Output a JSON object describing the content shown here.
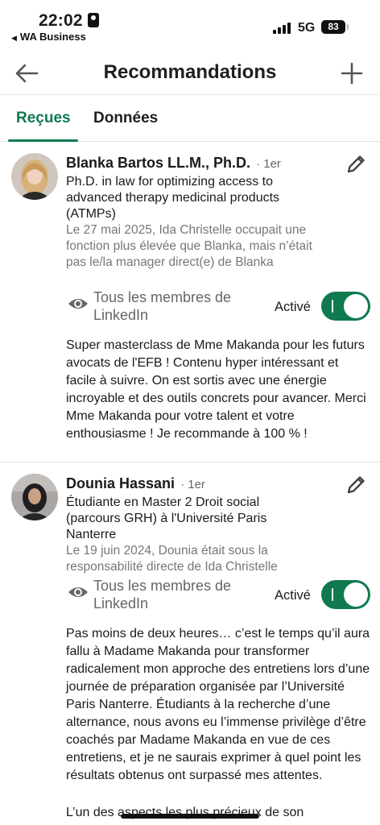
{
  "status_bar": {
    "time": "22:02",
    "back_app": "WA Business",
    "network": "5G",
    "battery": "83"
  },
  "header": {
    "title": "Recommandations",
    "back_icon": "arrow-left-icon",
    "add_icon": "plus-icon"
  },
  "tabs": [
    {
      "label": "Reçues",
      "active": true
    },
    {
      "label": "Données",
      "active": false
    }
  ],
  "accent_color": "#0f7a4f",
  "recommendations": [
    {
      "name": "Blanka Bartos LL.M., Ph.D.",
      "degree": "· 1er",
      "headline": "Ph.D. in law for optimizing access to advanced therapy medicinal products (ATMPs)",
      "context": "Le 27 mai 2025, Ida Christelle occupait une fonction plus élevée que Blanka, mais n’était pas le/la manager direct(e) de Blanka",
      "visibility": "Tous les membres de LinkedIn",
      "status": "Activé",
      "text": "Super masterclass de Mme Makanda pour les futurs avocats de l'EFB ! Contenu hyper intéressant et facile à suivre. On est sortis avec une énergie incroyable et des outils concrets pour avancer. Merci Mme Makanda pour votre talent et votre enthousiasme ! Je recommande à 100 % !"
    },
    {
      "name": "Dounia Hassani",
      "degree": "· 1er",
      "headline": "Étudiante en Master 2 Droit social (parcours GRH) à l'Université Paris Nanterre",
      "context": "Le 19 juin 2024, Dounia était sous la responsabilité directe de Ida Christelle",
      "visibility": "Tous les membres de LinkedIn",
      "status": "Activé",
      "text": "Pas moins de deux heures… c’est le temps qu’il aura fallu à Madame Makanda pour transformer radicalement mon approche des entretiens lors d’une journée de préparation organisée par l’Université Paris Nanterre. Étudiants à la recherche d’une alternance, nous avons eu l’immense privilège d’être coachés par Madame Makanda en vue de ces entretiens, et je ne saurais exprimer à quel point les résultats obtenus ont surpassé mes attentes.",
      "text2": "L’un des aspects les plus précieux de son"
    }
  ]
}
